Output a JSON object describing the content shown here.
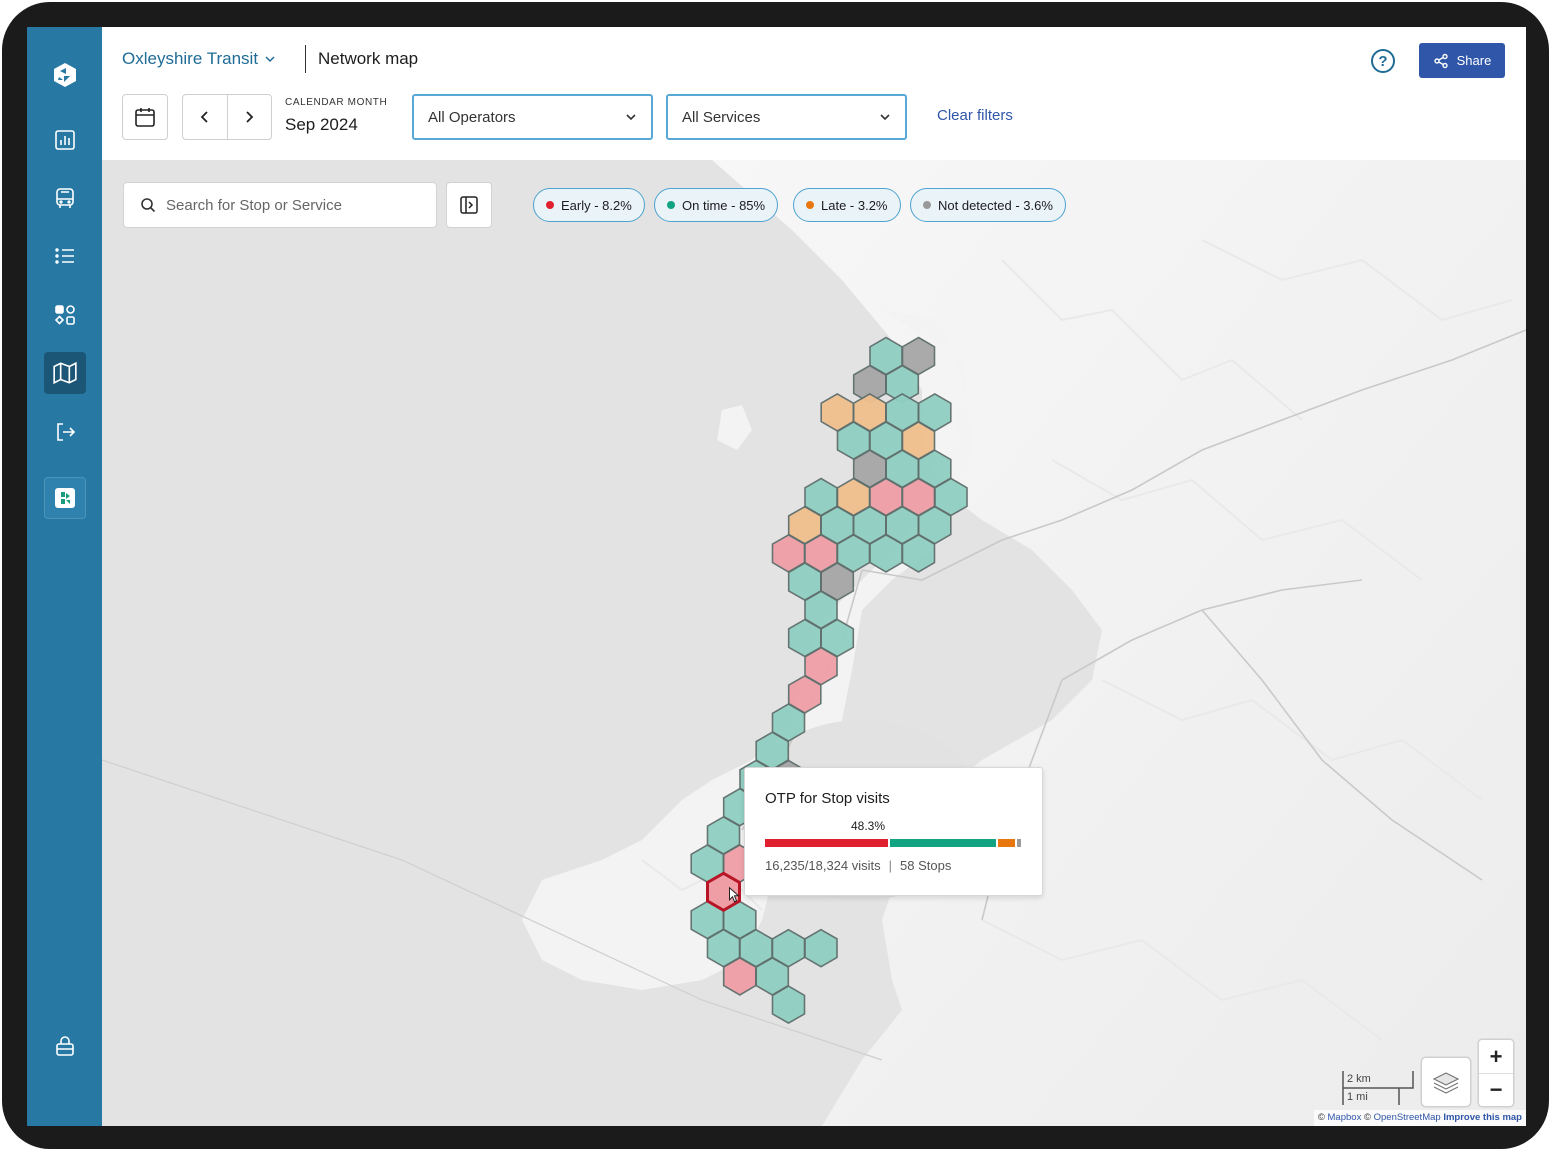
{
  "header": {
    "org_name": "Oxleyshire Transit",
    "page_title": "Network map",
    "share_label": "Share"
  },
  "date_filter": {
    "label": "CALENDAR MONTH",
    "value": "Sep 2024"
  },
  "filters": {
    "operators_value": "All Operators",
    "services_value": "All Services",
    "clear_label": "Clear filters"
  },
  "search": {
    "placeholder": "Search for Stop or Service"
  },
  "legend": [
    {
      "label": "Early - 8.2%",
      "color": "#e0202e"
    },
    {
      "label": "On time - 85%",
      "color": "#12a383"
    },
    {
      "label": "Late - 3.2%",
      "color": "#e8780e"
    },
    {
      "label": "Not detected - 3.6%",
      "color": "#9a9a9a"
    }
  ],
  "tooltip": {
    "title": "OTP for Stop visits",
    "percent": "48.3%",
    "visits": "16,235/18,324 visits",
    "stops": "58 Stops",
    "breakdown": [
      {
        "status": "early",
        "share": 0.483,
        "color": "#e0202e"
      },
      {
        "status": "on-time",
        "share": 0.42,
        "color": "#12a383"
      },
      {
        "status": "late",
        "share": 0.075,
        "color": "#e8780e"
      },
      {
        "status": "not-detected",
        "share": 0.022,
        "color": "#9a9a9a"
      }
    ]
  },
  "map_controls": {
    "zoom_in": "+",
    "zoom_out": "−",
    "scale_km": "2 km",
    "scale_mi": "1 mi"
  },
  "attribution": {
    "prefix_1": "©",
    "mapbox": "Mapbox",
    "prefix_2": "©",
    "osm": "OpenStreetMap",
    "improve": "Improve this map"
  },
  "colors": {
    "sidebar": "#2779a4",
    "sidebar_active": "#1c5677",
    "primary": "#2f56a8",
    "hex_on_time": "#8fd0c2",
    "hex_early": "#ef9ea6",
    "hex_late": "#f0c08d",
    "hex_not_detected": "#a6a6a6"
  }
}
